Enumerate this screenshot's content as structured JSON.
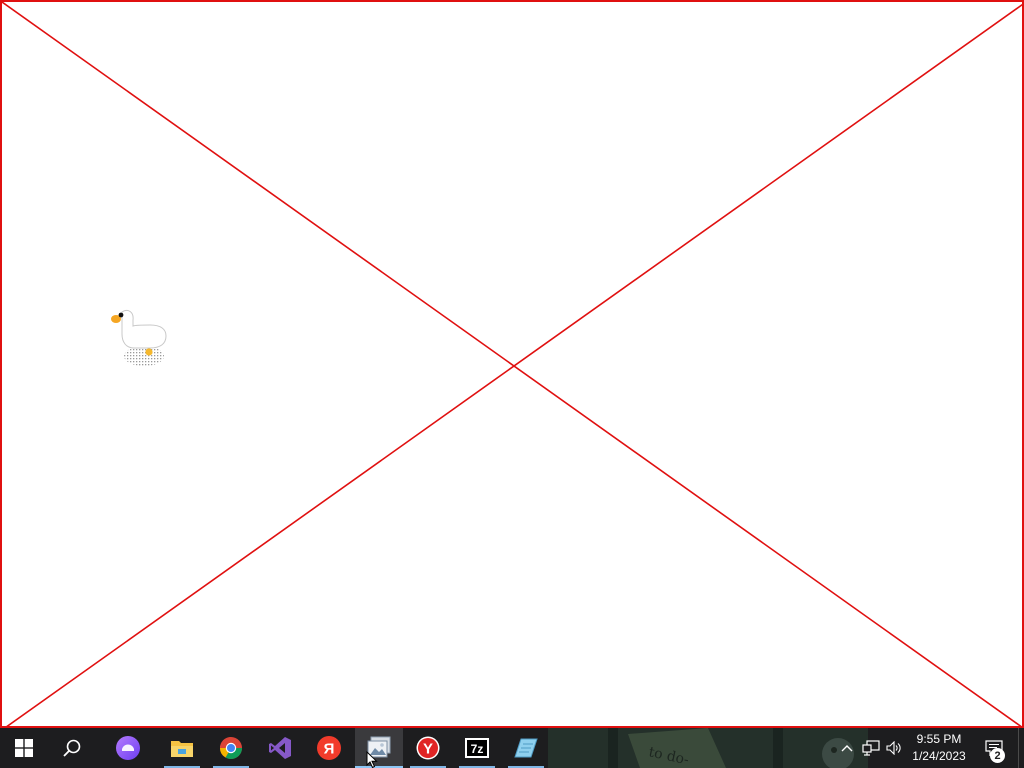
{
  "overlay": {
    "frame_color": "#e01010",
    "background_color": "#ffffff"
  },
  "desktop": {
    "pet": "goose-icon"
  },
  "taskbar": {
    "background_color": "#1d1d1f",
    "start_button": {
      "icon": "windows-start-icon"
    },
    "search_button": {
      "icon": "search-icon"
    },
    "apps": [
      {
        "name": "Alice",
        "icon": "alice-assistant-icon",
        "color": "#8a4dff",
        "running": false
      },
      {
        "name": "File Explorer",
        "icon": "folder-icon",
        "color": "#f6c343",
        "running": true
      },
      {
        "name": "Google Chrome",
        "icon": "chrome-icon",
        "color": "#4285f4",
        "running": true
      },
      {
        "name": "Visual Studio",
        "icon": "visual-studio-icon",
        "color": "#8659c8",
        "running": false
      },
      {
        "name": "Yandex",
        "icon": "yandex-icon",
        "label": "Я",
        "color": "#f23b2b",
        "running": false
      },
      {
        "name": "Photo Viewer",
        "icon": "photo-viewer-icon",
        "color": "#9fb3c8",
        "running": true,
        "active": true
      },
      {
        "name": "Yandex Browser",
        "icon": "yandex-browser-icon",
        "label": "Y",
        "color": "#e02424",
        "running": true
      },
      {
        "name": "7-Zip",
        "icon": "7zip-icon",
        "label": "7z",
        "color": "#ffffff",
        "running": true
      },
      {
        "name": "Notebook",
        "icon": "notebook-icon",
        "color": "#7fc6e8",
        "running": true
      }
    ],
    "tray": {
      "chevron_icon": "chevron-up-icon",
      "network_icon": "network-icon",
      "volume_icon": "volume-icon",
      "time": "9:55 PM",
      "date": "1/24/2023",
      "notification_icon": "action-center-icon",
      "notification_count": "2"
    }
  }
}
